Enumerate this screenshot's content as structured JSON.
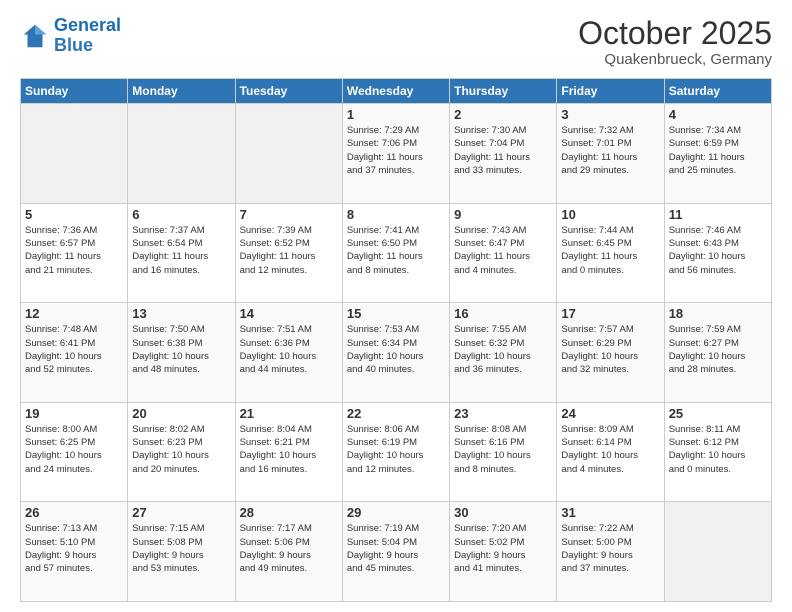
{
  "logo": {
    "line1": "General",
    "line2": "Blue"
  },
  "title": "October 2025",
  "subtitle": "Quakenbrueck, Germany",
  "weekdays": [
    "Sunday",
    "Monday",
    "Tuesday",
    "Wednesday",
    "Thursday",
    "Friday",
    "Saturday"
  ],
  "weeks": [
    [
      {
        "day": "",
        "info": ""
      },
      {
        "day": "",
        "info": ""
      },
      {
        "day": "",
        "info": ""
      },
      {
        "day": "1",
        "info": "Sunrise: 7:29 AM\nSunset: 7:06 PM\nDaylight: 11 hours\nand 37 minutes."
      },
      {
        "day": "2",
        "info": "Sunrise: 7:30 AM\nSunset: 7:04 PM\nDaylight: 11 hours\nand 33 minutes."
      },
      {
        "day": "3",
        "info": "Sunrise: 7:32 AM\nSunset: 7:01 PM\nDaylight: 11 hours\nand 29 minutes."
      },
      {
        "day": "4",
        "info": "Sunrise: 7:34 AM\nSunset: 6:59 PM\nDaylight: 11 hours\nand 25 minutes."
      }
    ],
    [
      {
        "day": "5",
        "info": "Sunrise: 7:36 AM\nSunset: 6:57 PM\nDaylight: 11 hours\nand 21 minutes."
      },
      {
        "day": "6",
        "info": "Sunrise: 7:37 AM\nSunset: 6:54 PM\nDaylight: 11 hours\nand 16 minutes."
      },
      {
        "day": "7",
        "info": "Sunrise: 7:39 AM\nSunset: 6:52 PM\nDaylight: 11 hours\nand 12 minutes."
      },
      {
        "day": "8",
        "info": "Sunrise: 7:41 AM\nSunset: 6:50 PM\nDaylight: 11 hours\nand 8 minutes."
      },
      {
        "day": "9",
        "info": "Sunrise: 7:43 AM\nSunset: 6:47 PM\nDaylight: 11 hours\nand 4 minutes."
      },
      {
        "day": "10",
        "info": "Sunrise: 7:44 AM\nSunset: 6:45 PM\nDaylight: 11 hours\nand 0 minutes."
      },
      {
        "day": "11",
        "info": "Sunrise: 7:46 AM\nSunset: 6:43 PM\nDaylight: 10 hours\nand 56 minutes."
      }
    ],
    [
      {
        "day": "12",
        "info": "Sunrise: 7:48 AM\nSunset: 6:41 PM\nDaylight: 10 hours\nand 52 minutes."
      },
      {
        "day": "13",
        "info": "Sunrise: 7:50 AM\nSunset: 6:38 PM\nDaylight: 10 hours\nand 48 minutes."
      },
      {
        "day": "14",
        "info": "Sunrise: 7:51 AM\nSunset: 6:36 PM\nDaylight: 10 hours\nand 44 minutes."
      },
      {
        "day": "15",
        "info": "Sunrise: 7:53 AM\nSunset: 6:34 PM\nDaylight: 10 hours\nand 40 minutes."
      },
      {
        "day": "16",
        "info": "Sunrise: 7:55 AM\nSunset: 6:32 PM\nDaylight: 10 hours\nand 36 minutes."
      },
      {
        "day": "17",
        "info": "Sunrise: 7:57 AM\nSunset: 6:29 PM\nDaylight: 10 hours\nand 32 minutes."
      },
      {
        "day": "18",
        "info": "Sunrise: 7:59 AM\nSunset: 6:27 PM\nDaylight: 10 hours\nand 28 minutes."
      }
    ],
    [
      {
        "day": "19",
        "info": "Sunrise: 8:00 AM\nSunset: 6:25 PM\nDaylight: 10 hours\nand 24 minutes."
      },
      {
        "day": "20",
        "info": "Sunrise: 8:02 AM\nSunset: 6:23 PM\nDaylight: 10 hours\nand 20 minutes."
      },
      {
        "day": "21",
        "info": "Sunrise: 8:04 AM\nSunset: 6:21 PM\nDaylight: 10 hours\nand 16 minutes."
      },
      {
        "day": "22",
        "info": "Sunrise: 8:06 AM\nSunset: 6:19 PM\nDaylight: 10 hours\nand 12 minutes."
      },
      {
        "day": "23",
        "info": "Sunrise: 8:08 AM\nSunset: 6:16 PM\nDaylight: 10 hours\nand 8 minutes."
      },
      {
        "day": "24",
        "info": "Sunrise: 8:09 AM\nSunset: 6:14 PM\nDaylight: 10 hours\nand 4 minutes."
      },
      {
        "day": "25",
        "info": "Sunrise: 8:11 AM\nSunset: 6:12 PM\nDaylight: 10 hours\nand 0 minutes."
      }
    ],
    [
      {
        "day": "26",
        "info": "Sunrise: 7:13 AM\nSunset: 5:10 PM\nDaylight: 9 hours\nand 57 minutes."
      },
      {
        "day": "27",
        "info": "Sunrise: 7:15 AM\nSunset: 5:08 PM\nDaylight: 9 hours\nand 53 minutes."
      },
      {
        "day": "28",
        "info": "Sunrise: 7:17 AM\nSunset: 5:06 PM\nDaylight: 9 hours\nand 49 minutes."
      },
      {
        "day": "29",
        "info": "Sunrise: 7:19 AM\nSunset: 5:04 PM\nDaylight: 9 hours\nand 45 minutes."
      },
      {
        "day": "30",
        "info": "Sunrise: 7:20 AM\nSunset: 5:02 PM\nDaylight: 9 hours\nand 41 minutes."
      },
      {
        "day": "31",
        "info": "Sunrise: 7:22 AM\nSunset: 5:00 PM\nDaylight: 9 hours\nand 37 minutes."
      },
      {
        "day": "",
        "info": ""
      }
    ]
  ]
}
